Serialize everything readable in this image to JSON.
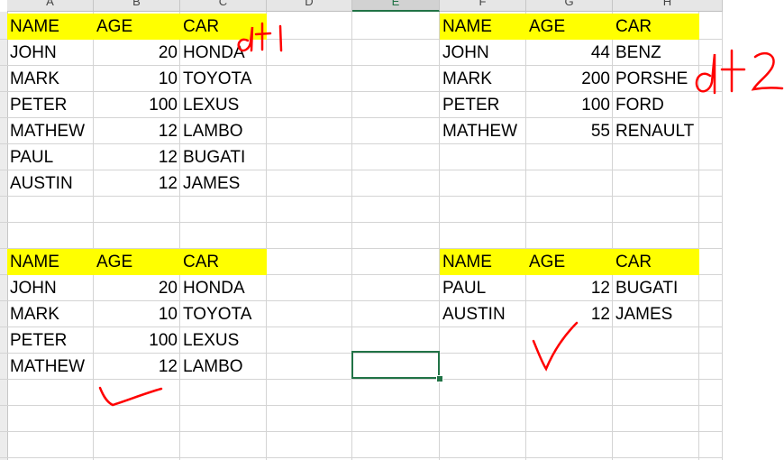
{
  "columns": [
    "A",
    "B",
    "C",
    "D",
    "E",
    "F",
    "G",
    "H"
  ],
  "selected_column": "E",
  "table_dt1": {
    "headers": [
      "NAME",
      "AGE",
      "CAR"
    ],
    "rows": [
      [
        "JOHN",
        "20",
        "HONDA"
      ],
      [
        "MARK",
        "10",
        "TOYOTA"
      ],
      [
        "PETER",
        "100",
        "LEXUS"
      ],
      [
        "MATHEW",
        "12",
        "LAMBO"
      ],
      [
        "PAUL",
        "12",
        "BUGATI"
      ],
      [
        "AUSTIN",
        "12",
        "JAMES"
      ]
    ]
  },
  "table_dt2": {
    "headers": [
      "NAME",
      "AGE",
      "CAR"
    ],
    "rows": [
      [
        "JOHN",
        "44",
        "BENZ"
      ],
      [
        "MARK",
        "200",
        "PORSHE"
      ],
      [
        "PETER",
        "100",
        "FORD"
      ],
      [
        "MATHEW",
        "55",
        "RENAULT"
      ]
    ]
  },
  "table_match": {
    "headers": [
      "NAME",
      "AGE",
      "CAR"
    ],
    "rows": [
      [
        "JOHN",
        "20",
        "HONDA"
      ],
      [
        "MARK",
        "10",
        "TOYOTA"
      ],
      [
        "PETER",
        "100",
        "LEXUS"
      ],
      [
        "MATHEW",
        "12",
        "LAMBO"
      ]
    ]
  },
  "table_nomatch": {
    "headers": [
      "NAME",
      "AGE",
      "CAR"
    ],
    "rows": [
      [
        "PAUL",
        "12",
        "BUGATI"
      ],
      [
        "AUSTIN",
        "12",
        "JAMES"
      ]
    ]
  },
  "annotations": {
    "dt1_label": "dt1",
    "dt2_label": "dt2",
    "ink_color": "#ff0000"
  },
  "colors": {
    "header_fill": "#ffff00",
    "selection": "#217346",
    "gridline": "#d4d4d4"
  }
}
